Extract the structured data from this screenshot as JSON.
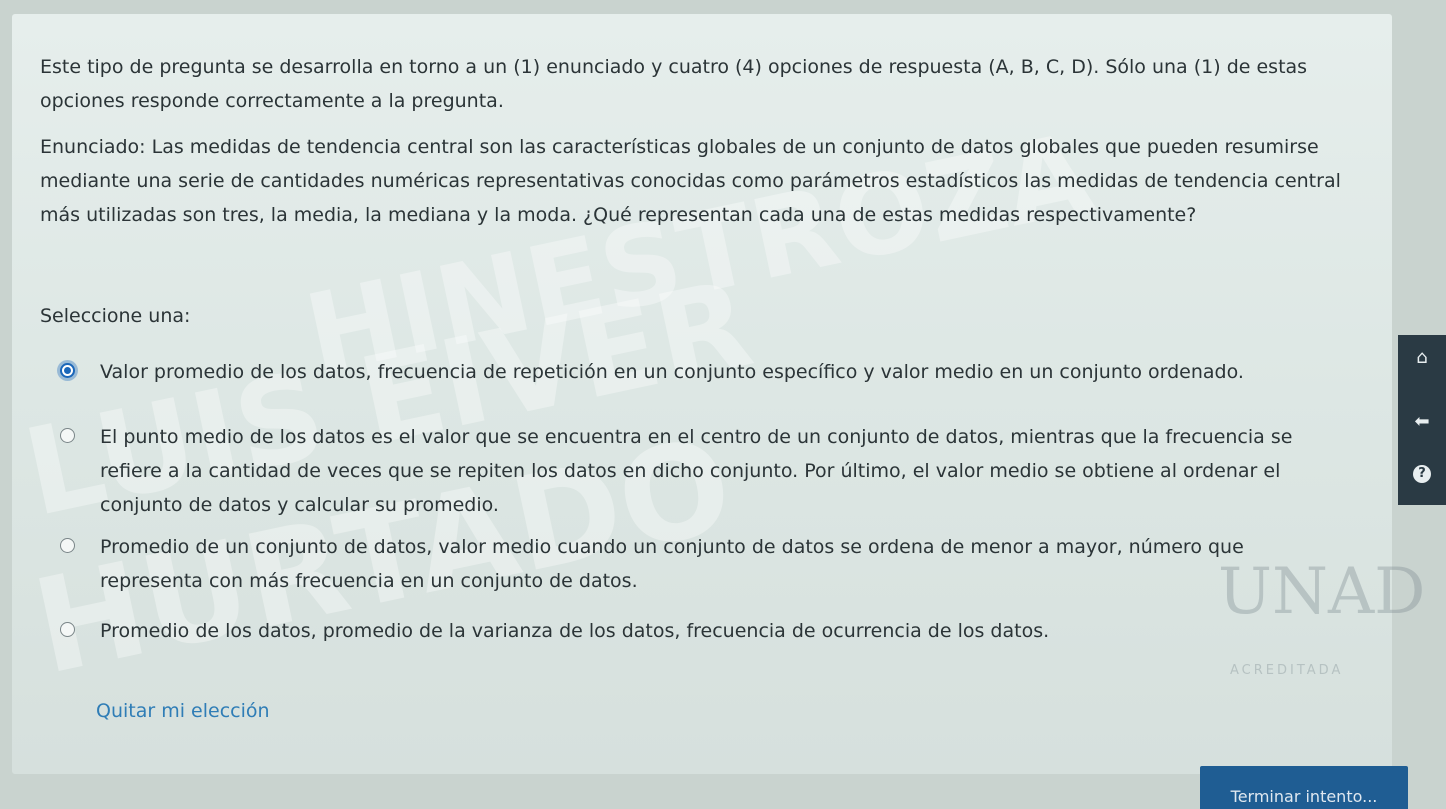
{
  "question": {
    "instructions": "Este tipo de pregunta se desarrolla en torno a un (1) enunciado y cuatro (4) opciones de respuesta (A, B, C, D). Sólo una (1) de estas opciones responde correctamente a la pregunta.",
    "statement": "Enunciado: Las medidas de tendencia central son las características globales de un conjunto de datos globales que pueden resumirse mediante una serie de cantidades numéricas representativas conocidas como parámetros estadísticos las medidas de tendencia central más utilizadas son tres, la media, la mediana y la moda. ¿Qué representan cada una de estas medidas respectivamente?",
    "select_label": "Seleccione una:",
    "options": [
      {
        "label": "Valor promedio de los datos, frecuencia de repetición en un conjunto específico y valor medio en un conjunto ordenado.",
        "selected": true
      },
      {
        "label": "El punto medio de los datos es el valor que se encuentra en el centro de un conjunto de datos, mientras que la frecuencia se refiere a la cantidad de veces que se repiten los datos en dicho conjunto. Por último, el valor medio se obtiene al ordenar el conjunto de datos y calcular su promedio.",
        "selected": false
      },
      {
        "label": "Promedio de un conjunto de datos, valor medio cuando un conjunto de datos se ordena de menor a mayor, número que representa con más frecuencia en un conjunto de datos.",
        "selected": false
      },
      {
        "label": "Promedio de los datos, promedio de la varianza de los datos, frecuencia de ocurrencia de los datos.",
        "selected": false
      }
    ],
    "clear_choice": "Quitar mi elección"
  },
  "watermark": {
    "line1": "HINESTROZA",
    "line2": "LUIS EIVER",
    "line3": "HURTADO"
  },
  "logo": {
    "text": "UNAD",
    "sub": "ACREDITADA"
  },
  "footer": {
    "finish_button": "Terminar intento..."
  },
  "side_icons": [
    "home-icon",
    "arrow-left-icon",
    "help-icon"
  ],
  "colors": {
    "accent": "#1b67b9",
    "link": "#2f7db6",
    "button": "#1f5d93"
  }
}
